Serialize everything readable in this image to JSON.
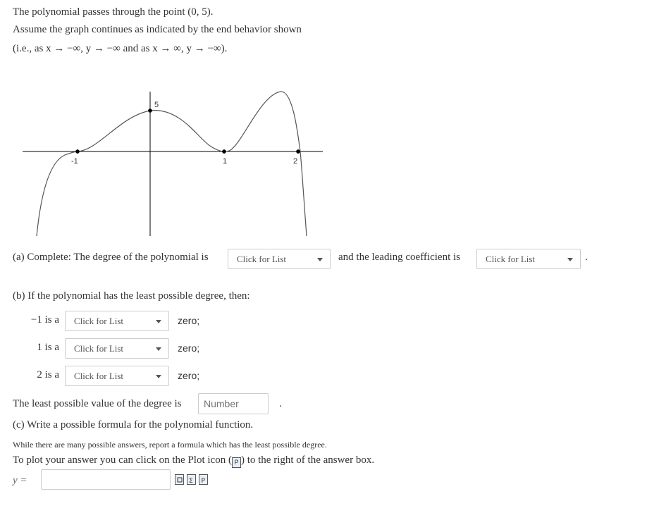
{
  "intro": {
    "line1": "The polynomial passes through the point (0, 5).",
    "line2": "Assume the graph continues as indicated by the end behavior shown",
    "line3": "(i.e., as x → −∞, y → −∞ and as x → ∞, y → −∞)."
  },
  "graph": {
    "tick_labels": [
      "-1",
      "1",
      "2",
      "5"
    ]
  },
  "part_a": {
    "prefix": "(a) Complete: The degree of the polynomial is",
    "select1": "Click for List",
    "middle": "and the leading coefficient is",
    "select2": "Click for List",
    "suffix": "."
  },
  "part_b": {
    "heading": "(b) If the polynomial has the least possible degree, then:",
    "rows": [
      {
        "label": "−1  is a",
        "select": "Click for List",
        "suffix": "zero;"
      },
      {
        "label": "1  is a",
        "select": "Click for List",
        "suffix": "zero;"
      },
      {
        "label": "2  is a",
        "select": "Click for List",
        "suffix": "zero;"
      }
    ],
    "least_degree_text": "The least possible value of the degree is",
    "least_degree_placeholder": "Number",
    "least_degree_suffix": "."
  },
  "part_c": {
    "heading": "(c) Write a possible formula for the polynomial function.",
    "note": "While there are many possible answers, report a formula which has the least possible degree.",
    "plot_text_before": "To plot your answer you can click on the Plot icon (",
    "plot_text_after": ") to the right of the answer box.",
    "answer_label": "y ="
  },
  "icons": [
    "preview-icon",
    "formula-icon",
    "plot-icon"
  ]
}
